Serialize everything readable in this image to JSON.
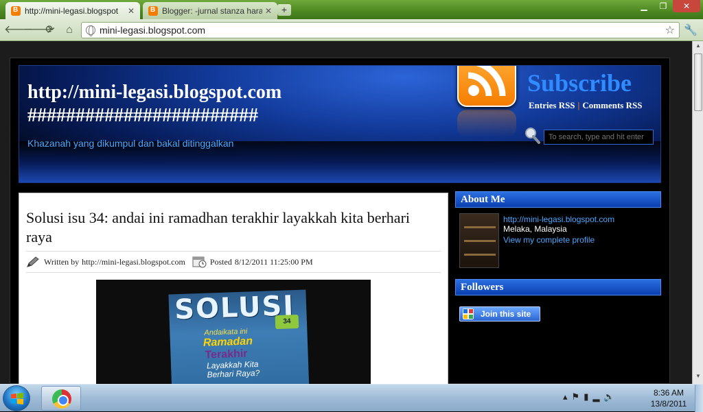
{
  "browser": {
    "tabs": [
      {
        "title": "http://mini-legasi.blogspot"
      },
      {
        "title": "Blogger: -jurnal stanza hara"
      }
    ],
    "new_tab_label": "+",
    "url": "mini-legasi.blogspot.com"
  },
  "header": {
    "title_line1": "http://mini-legasi.blogspot.com",
    "title_line2": "########################",
    "description": "Khazanah yang dikumpul dan bakal ditinggalkan",
    "subscribe": "Subscribe",
    "entries_rss": "Entries RSS",
    "separator": "|",
    "comments_rss": "Comments RSS",
    "search_placeholder": "To search, type and hit enter"
  },
  "post": {
    "title": "Solusi isu 34: andai ini ramadhan terakhir layakkah kita berhari raya",
    "written_by_label": "Written by",
    "author": "http://mini-legasi.blogspot.com",
    "posted_label": "Posted",
    "posted_date": "8/12/2011 11:25:00 PM",
    "image": {
      "mag_title": "SOLUSI",
      "line1": "Andaikata ini",
      "line2": "Ramadan",
      "line3": "Terakhir",
      "line4": "Layakkah Kita Berhari Raya?",
      "badge": "34"
    }
  },
  "sidebar": {
    "about_title": "About Me",
    "profile_name": "http://mini-legasi.blogspot.com",
    "location": "Melaka, Malaysia",
    "profile_link": "View my complete profile",
    "followers_title": "Followers",
    "join_label": "Join this site"
  },
  "taskbar": {
    "time": "8:36 AM",
    "date": "13/8/2011"
  },
  "colors": {
    "browser_frame": "#4f8a23",
    "header_blue": "#123a9a",
    "link_blue": "#4aa8ff",
    "rss_orange": "#f57d00",
    "widget_blue": "#0a3fb0"
  }
}
